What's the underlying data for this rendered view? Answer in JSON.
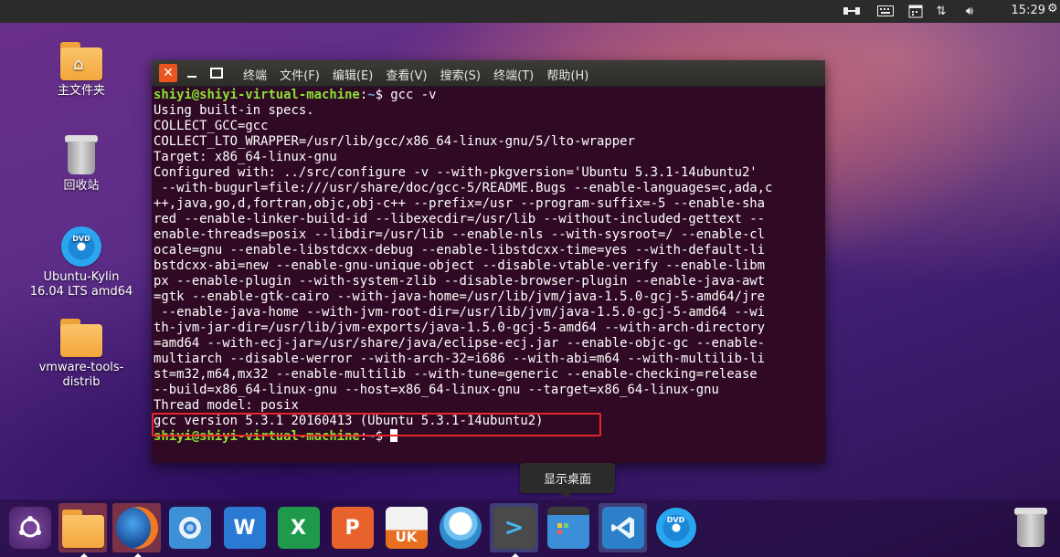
{
  "top_panel": {
    "clock": "15:29"
  },
  "desktop": {
    "icons": [
      {
        "label": "主文件夹"
      },
      {
        "label": "回收站"
      },
      {
        "label": "Ubuntu-Kylin 16.04 LTS amd64"
      },
      {
        "label": "vmware-tools-distrib"
      }
    ],
    "dvd_text": "DVD"
  },
  "terminal": {
    "title": "终端",
    "menu": [
      "文件(F)",
      "编辑(E)",
      "查看(V)",
      "搜索(S)",
      "终端(T)",
      "帮助(H)"
    ],
    "prompt_user": "shiyi@shiyi-virtual-machine",
    "prompt_path": "~",
    "command": "gcc -v",
    "output_lines": [
      "Using built-in specs.",
      "COLLECT_GCC=gcc",
      "COLLECT_LTO_WRAPPER=/usr/lib/gcc/x86_64-linux-gnu/5/lto-wrapper",
      "Target: x86_64-linux-gnu",
      "Configured with: ../src/configure -v --with-pkgversion='Ubuntu 5.3.1-14ubuntu2'",
      " --with-bugurl=file:///usr/share/doc/gcc-5/README.Bugs --enable-languages=c,ada,c",
      "++,java,go,d,fortran,objc,obj-c++ --prefix=/usr --program-suffix=-5 --enable-sha",
      "red --enable-linker-build-id --libexecdir=/usr/lib --without-included-gettext --",
      "enable-threads=posix --libdir=/usr/lib --enable-nls --with-sysroot=/ --enable-cl",
      "ocale=gnu --enable-libstdcxx-debug --enable-libstdcxx-time=yes --with-default-li",
      "bstdcxx-abi=new --enable-gnu-unique-object --disable-vtable-verify --enable-libm",
      "px --enable-plugin --with-system-zlib --disable-browser-plugin --enable-java-awt",
      "=gtk --enable-gtk-cairo --with-java-home=/usr/lib/jvm/java-1.5.0-gcj-5-amd64/jre",
      " --enable-java-home --with-jvm-root-dir=/usr/lib/jvm/java-1.5.0-gcj-5-amd64 --wi",
      "th-jvm-jar-dir=/usr/lib/jvm-exports/java-1.5.0-gcj-5-amd64 --with-arch-directory",
      "=amd64 --with-ecj-jar=/usr/share/java/eclipse-ecj.jar --enable-objc-gc --enable-",
      "multiarch --disable-werror --with-arch-32=i686 --with-abi=m64 --with-multilib-li",
      "st=m32,m64,mx32 --enable-multilib --with-tune=generic --enable-checking=release",
      "--build=x86_64-linux-gnu --host=x86_64-linux-gnu --target=x86_64-linux-gnu",
      "Thread model: posix"
    ],
    "version_line": "gcc version 5.3.1 20160413 (Ubuntu 5.3.1-14ubuntu2)"
  },
  "tooltip": "显示桌面",
  "dock": {
    "items": [
      {
        "name": "ubuntu-kylin-logo"
      },
      {
        "name": "files"
      },
      {
        "name": "firefox"
      },
      {
        "name": "chromium"
      },
      {
        "name": "wps-writer",
        "glyph": "W"
      },
      {
        "name": "wps-spreadsheets",
        "glyph": "X"
      },
      {
        "name": "wps-presentation",
        "glyph": "P"
      },
      {
        "name": "ubuntu-kylin-software-center",
        "glyph": "UK"
      },
      {
        "name": "youker-assistant"
      },
      {
        "name": "terminal-launcher",
        "glyph": ">"
      },
      {
        "name": "show-desktop"
      },
      {
        "name": "vscode"
      },
      {
        "name": "dvd-drive",
        "glyph": "DVD"
      },
      {
        "name": "trash"
      }
    ]
  },
  "colors": {
    "terminal_bg": "#300a24",
    "prompt_user": "#8ae234",
    "prompt_path": "#729fcf",
    "highlight_box": "#e5252a",
    "close_button": "#e95420"
  }
}
